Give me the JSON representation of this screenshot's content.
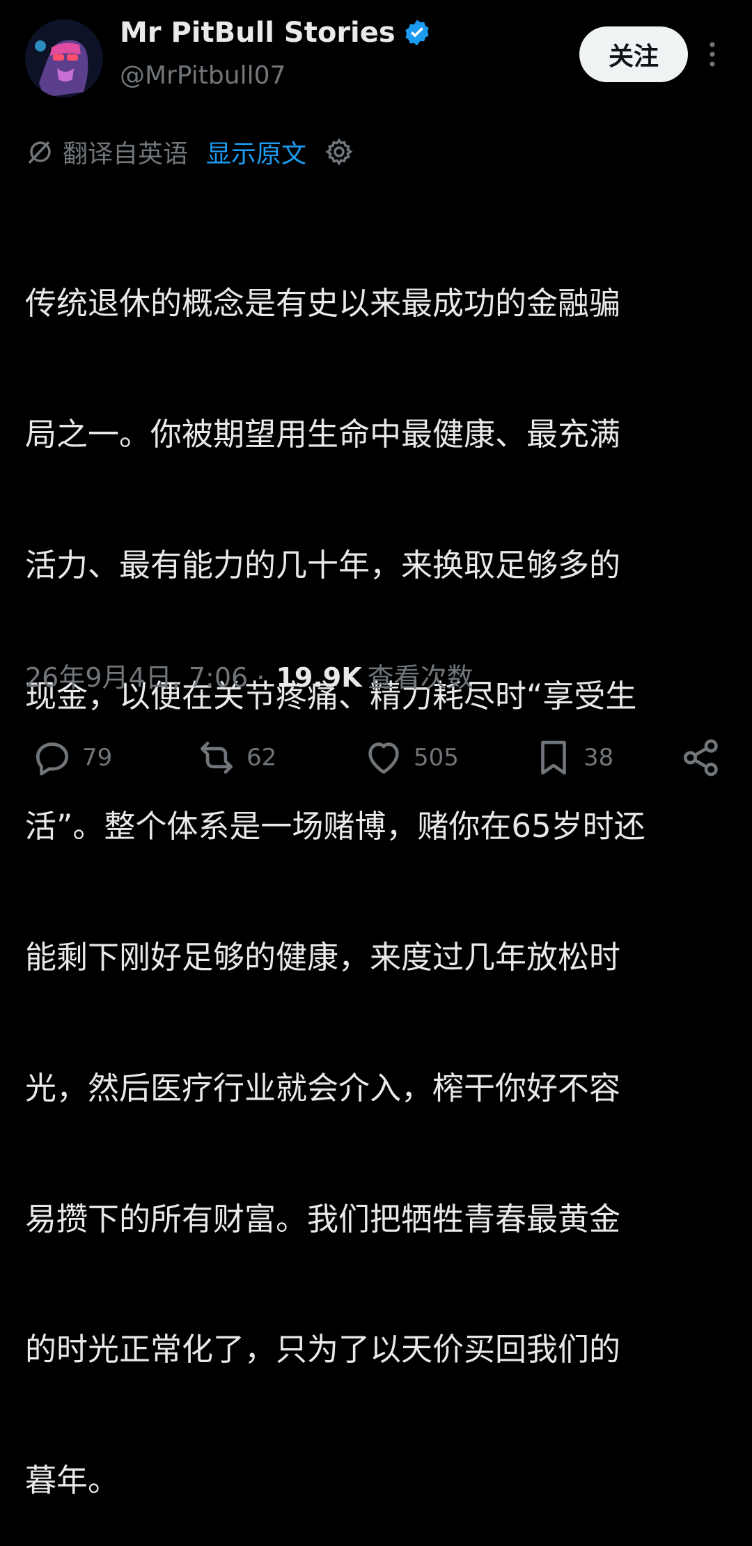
{
  "author": {
    "display_name": "Mr PitBull Stories",
    "handle": "@MrPitbull07",
    "verified": true
  },
  "follow_button": "关注",
  "translation": {
    "label": "翻译自英语",
    "show_original": "显示原文"
  },
  "tweet_lines": [
    "传统退休的概念是有史以来最成功的金融骗",
    "局之一。你被期望用生命中最健康、最充满",
    "活力、最有能力的几十年，来换取足够多的",
    "现金，以便在关节疼痛、精力耗尽时“享受生",
    "活”。整个体系是一场赌博，赌你在65岁时还",
    "能剩下刚好足够的健康，来度过几年放松时",
    "光，然后医疗行业就会介入，榨干你好不容",
    "易攒下的所有财富。我们把牺牲青春最黄金",
    "的时光正常化了，只为了以天价买回我们的",
    "暮年。"
  ],
  "meta": {
    "timestamp": "26年9月4日, 7:06",
    "separator": " · ",
    "views": "19.9K",
    "views_label": "查看次数"
  },
  "actions": {
    "replies": "79",
    "reposts": "62",
    "likes": "505",
    "bookmarks": "38"
  },
  "colors": {
    "background": "#000000",
    "text": "#e7e9ea",
    "muted": "#71767b",
    "link": "#1d9bf0",
    "verified": "#1d9bf0"
  }
}
